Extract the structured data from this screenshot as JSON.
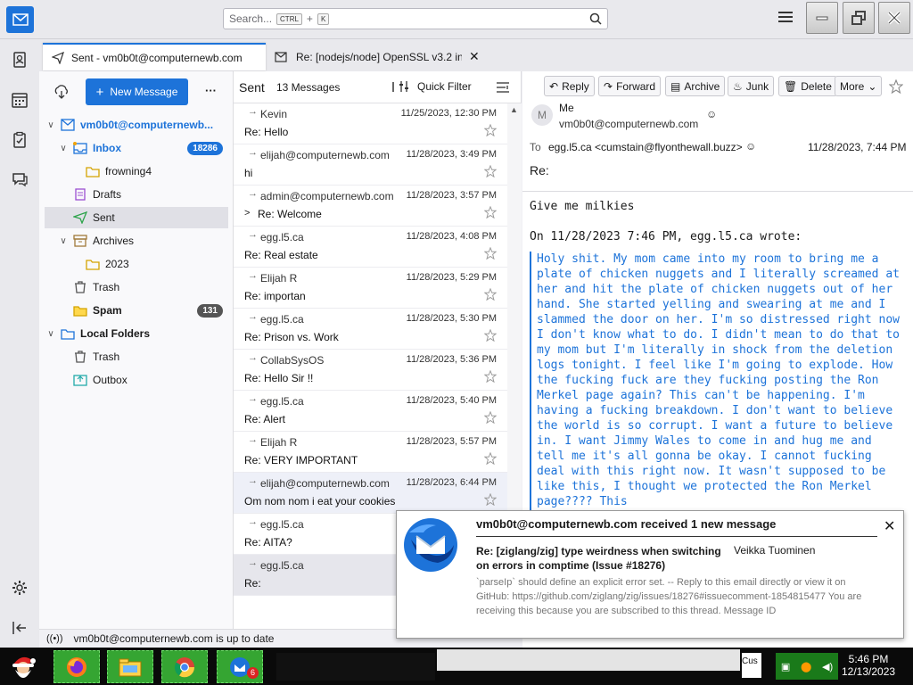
{
  "search": {
    "placeholder": "Search...",
    "kbd1": "CTRL",
    "plus": "+",
    "kbd2": "K"
  },
  "tabs": [
    {
      "label": "Sent - vm0b0t@computernewb.com"
    },
    {
      "label": "Re: [nodejs/node] OpenSSL v3.2 in"
    }
  ],
  "folder_pane": {
    "new_message": "New Message",
    "more": "···",
    "folders": [
      {
        "label": "vm0b0t@computernewb...",
        "bold": true,
        "color": "#1d73d9"
      },
      {
        "label": "Inbox",
        "badge": "18286",
        "bold": true,
        "color": "#1d73d9"
      },
      {
        "label": "frowning4"
      },
      {
        "label": "Drafts"
      },
      {
        "label": "Sent"
      },
      {
        "label": "Archives"
      },
      {
        "label": "2023"
      },
      {
        "label": "Trash"
      },
      {
        "label": "Spam",
        "badge": "131",
        "bold": true
      },
      {
        "label": "Local Folders",
        "bold": true
      },
      {
        "label": "Trash"
      },
      {
        "label": "Outbox"
      }
    ]
  },
  "thread_pane": {
    "folder_name": "Sent",
    "count": "13 Messages",
    "quick_filter": "Quick Filter",
    "messages": [
      {
        "sender": "Kevin",
        "date": "11/25/2023, 12:30 PM",
        "subject": "Re: Hello"
      },
      {
        "sender": "elijah@computernewb.com",
        "date": "11/28/2023, 3:49 PM",
        "subject": "hi"
      },
      {
        "sender": "admin@computernewb.com",
        "date": "11/28/2023, 3:57 PM",
        "subject": "Re: Welcome"
      },
      {
        "sender": "egg.l5.ca",
        "date": "11/28/2023, 4:08 PM",
        "subject": "Re: Real estate"
      },
      {
        "sender": "Elijah R",
        "date": "11/28/2023, 5:29 PM",
        "subject": "Re: importan"
      },
      {
        "sender": "egg.l5.ca",
        "date": "11/28/2023, 5:30 PM",
        "subject": "Re: Prison vs. Work"
      },
      {
        "sender": "CollabSysOS",
        "date": "11/28/2023, 5:36 PM",
        "subject": "Re: Hello Sir !!"
      },
      {
        "sender": "egg.l5.ca",
        "date": "11/28/2023, 5:40 PM",
        "subject": "Re: Alert"
      },
      {
        "sender": "Elijah R",
        "date": "11/28/2023, 5:57 PM",
        "subject": "Re: VERY IMPORTANT"
      },
      {
        "sender": "elijah@computernewb.com",
        "date": "11/28/2023, 6:44 PM",
        "subject": "Om nom nom i eat your cookies"
      },
      {
        "sender": "egg.l5.ca",
        "date": "",
        "subject": "Re: AITA?"
      },
      {
        "sender": "egg.l5.ca",
        "date": "",
        "subject": "Re:"
      }
    ]
  },
  "message": {
    "buttons": {
      "reply": "Reply",
      "forward": "Forward",
      "archive": "Archive",
      "junk": "Junk",
      "delete": "Delete",
      "more": "More"
    },
    "from_name": "Me",
    "from_addr": "vm0b0t@computernewb.com",
    "to_label": "To",
    "to": "egg.l5.ca <cumstain@flyonthewall.buzz>",
    "date": "11/28/2023, 7:44 PM",
    "subject": "Re:",
    "body_line": "Give me milkies",
    "attribution": "On 11/28/2023 7:46 PM, egg.l5.ca wrote:",
    "quote": "Holy shit. My mom came into my room to bring me a plate of chicken nuggets and I literally screamed at her and hit the plate of chicken nuggets out of her hand. She started yelling and swearing at me and I slammed the door on her. I'm so distressed right now I don't know what to do. I didn't mean to do that to my mom but I'm literally in shock from the deletion logs tonight. I feel like I'm going to explode. How the fucking fuck are they fucking posting the Ron Merkel page again? This can't be happening. I'm having a fucking breakdown. I don't want to believe the world is so corrupt. I want a future to believe in. I want Jimmy Wales to come in and hug me and tell me it's all gonna be okay. I cannot fucking deal with this right now. It wasn't supposed to be like this, I thought we protected the Ron Merkel page???? This"
  },
  "notification": {
    "title": "vm0b0t@computernewb.com received 1 new message",
    "subject": "Re: [ziglang/zig] type weirdness when switching on errors in comptime (Issue #18276)",
    "from": "Veikka Tuominen",
    "preview": "`parseIp` should define an explicit error set. -- Reply to this email directly or view it on GitHub: https://github.com/ziglang/zig/issues/18276#issuecomment-1854815477 You are receiving this because you are subscribed to this thread. Message ID"
  },
  "status": {
    "text": "vm0b0t@computernewb.com is up to date"
  },
  "taskbar": {
    "time": "5:46 PM",
    "date": "12/13/2023",
    "firefox_badge": "6",
    "tray_text": "Cus"
  },
  "colors": {
    "accent": "#1d73d9",
    "inbox_badge": "#1d73d9",
    "spam_badge": "#555555",
    "taskbar_app": "#35a532"
  }
}
